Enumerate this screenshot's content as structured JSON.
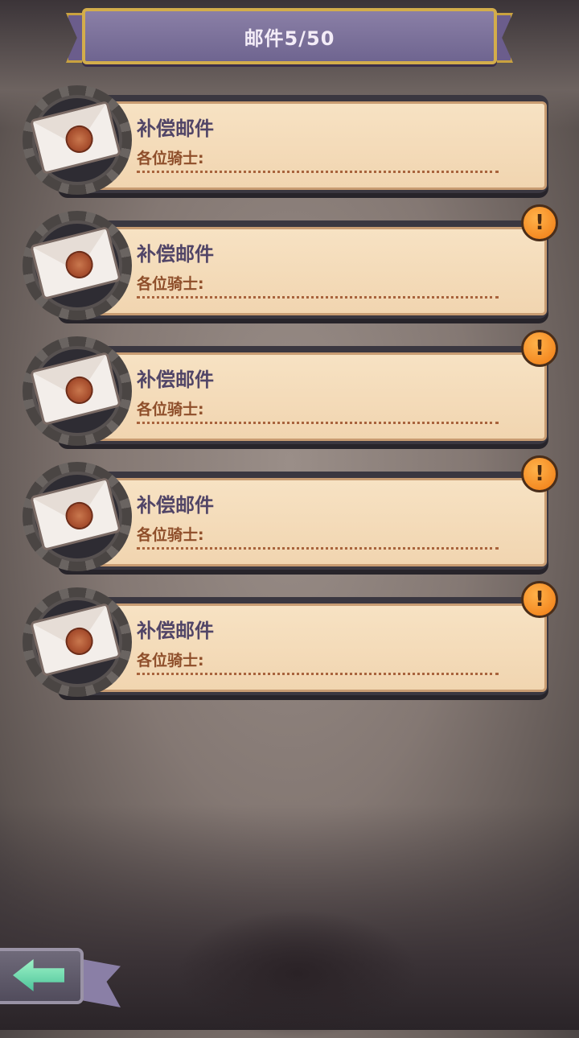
{
  "header": {
    "title": "邮件5/50"
  },
  "mails": [
    {
      "title": "补偿邮件",
      "greeting": "各位骑士:",
      "unread": false
    },
    {
      "title": "补偿邮件",
      "greeting": "各位骑士:",
      "unread": true
    },
    {
      "title": "补偿邮件",
      "greeting": "各位骑士:",
      "unread": true
    },
    {
      "title": "补偿邮件",
      "greeting": "各位骑士:",
      "unread": true
    },
    {
      "title": "补偿邮件",
      "greeting": "各位骑士:",
      "unread": true
    }
  ],
  "icons": {
    "envelope": "envelope-icon",
    "alert": "exclamation-icon",
    "back": "back-arrow-icon"
  },
  "alert_symbol": "!",
  "colors": {
    "banner": "#6f6590",
    "banner_border": "#d3ad4b",
    "paper": "#f3dbb8",
    "title_text": "#514567",
    "greeting_text": "#8e4e2a",
    "alert": "#f08a1c",
    "back_arrow": "#6fdcaf"
  }
}
